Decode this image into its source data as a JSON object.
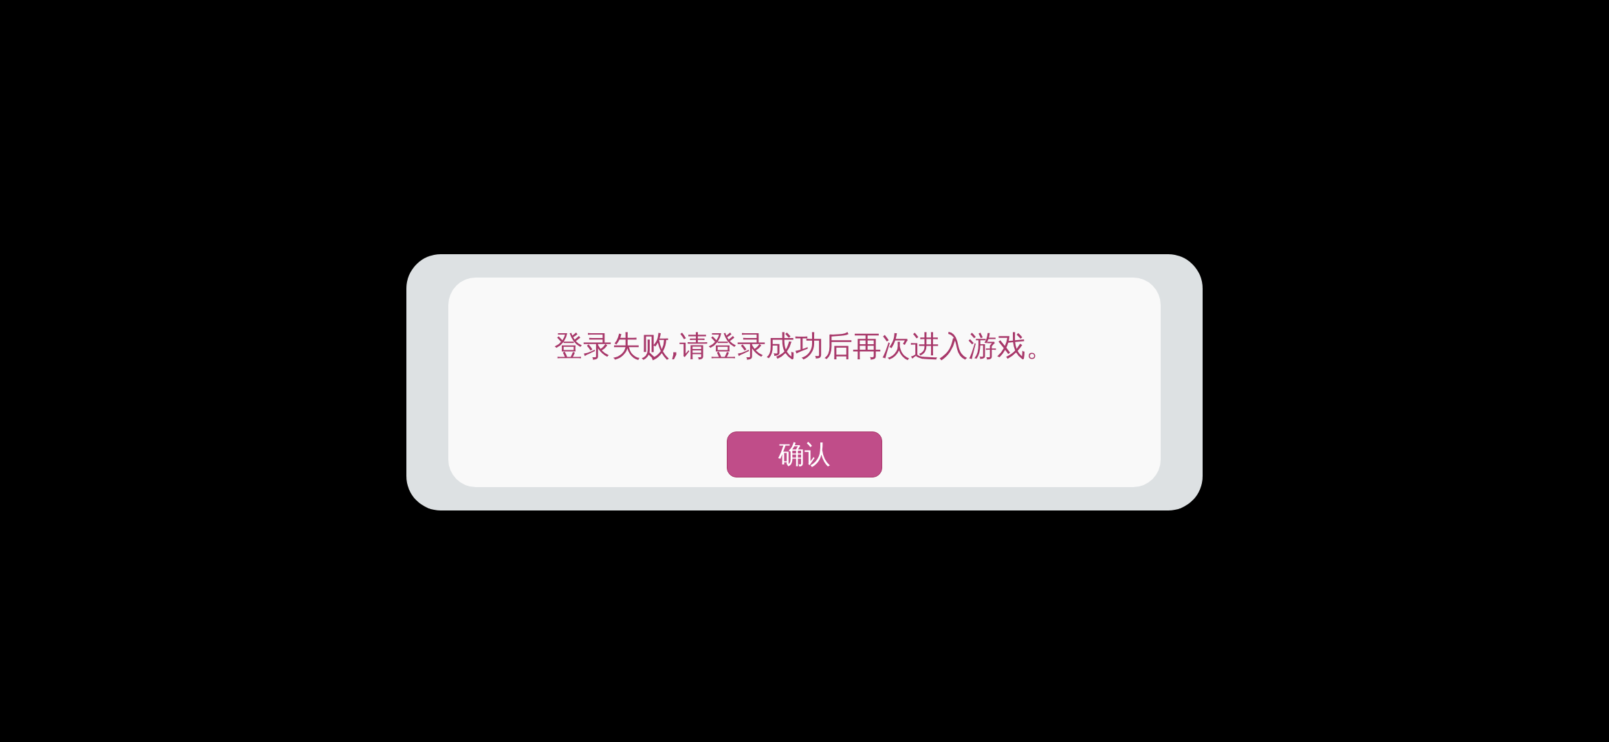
{
  "dialog": {
    "message": "登录失败,请登录成功后再次进入游戏。",
    "confirm_button": "确认"
  }
}
